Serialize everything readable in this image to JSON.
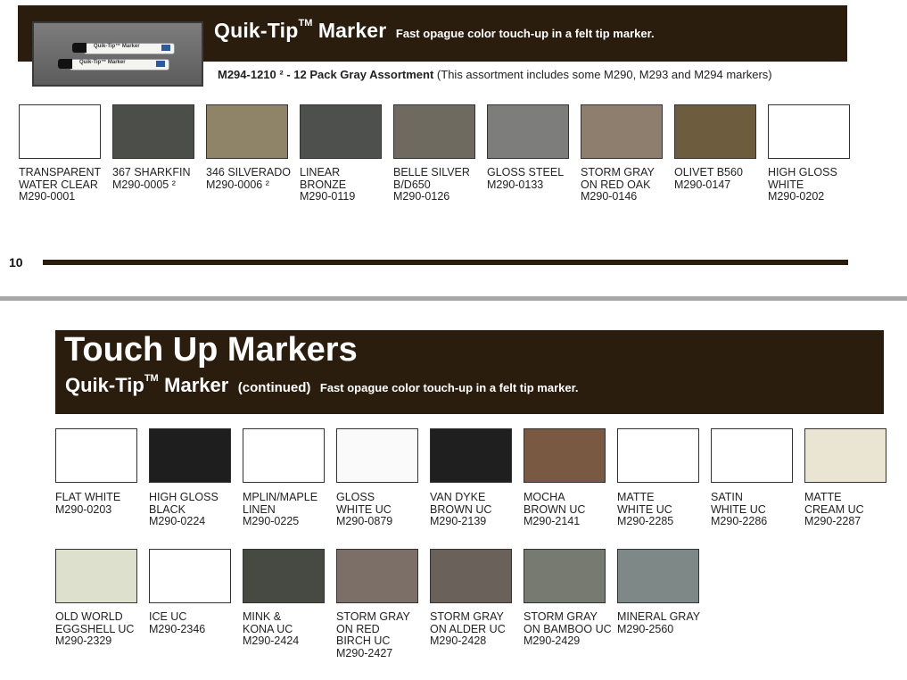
{
  "top_header": {
    "title": "Quik-Tip",
    "trademark": "TM",
    "title_word": "Marker",
    "tagline": "Fast opague color touch-up in a felt tip marker.",
    "pen_label": "Quik-Tip™ Marker"
  },
  "assortment": {
    "code": "M294-1210 ² - 12 Pack Gray Assortment",
    "note": " (This assortment includes some M290, M293 and M294 markers)"
  },
  "top_swatches": [
    {
      "lines": [
        "TRANSPARENT",
        "WATER CLEAR",
        "M290-0001"
      ],
      "color": "#ffffff"
    },
    {
      "lines": [
        "367 SHARKFIN",
        "M290-0005 ²"
      ],
      "color": "#4c4f49"
    },
    {
      "lines": [
        "346 SILVERADO",
        "M290-0006 ²"
      ],
      "color": "#8f8468"
    },
    {
      "lines": [
        "LINEAR",
        "BRONZE",
        "M290-0119"
      ],
      "color": "#4d504c"
    },
    {
      "lines": [
        "BELLE SILVER",
        "B/D650",
        "M290-0126"
      ],
      "color": "#6e6a60"
    },
    {
      "lines": [
        "GLOSS STEEL",
        "M290-0133"
      ],
      "color": "#7d7e7b"
    },
    {
      "lines": [
        "STORM GRAY",
        "ON RED OAK",
        "M290-0146"
      ],
      "color": "#8e7e6d"
    },
    {
      "lines": [
        "OLIVET B560",
        "M290-0147"
      ],
      "color": "#6e5c3f"
    },
    {
      "lines": [
        "HIGH GLOSS",
        "WHITE",
        "M290-0202"
      ],
      "color": "#ffffff"
    }
  ],
  "page_number": "10",
  "bottom_header": {
    "title": "Touch Up Markers",
    "marker": "Quik-Tip",
    "trademark": "TM",
    "marker_word": "Marker",
    "continued": "(continued)",
    "tagline": "Fast opague color touch-up in a felt tip marker."
  },
  "row1_swatches": [
    {
      "lines": [
        "FLAT WHITE",
        "M290-0203"
      ],
      "color": "#ffffff"
    },
    {
      "lines": [
        "HIGH GLOSS",
        "BLACK",
        "M290-0224"
      ],
      "color": "#1e1e1e"
    },
    {
      "lines": [
        "MPLIN/MAPLE",
        "LINEN",
        "M290-0225"
      ],
      "color": "#ffffff"
    },
    {
      "lines": [
        "GLOSS",
        "WHITE UC",
        "M290-0879"
      ],
      "color": "#fafafa"
    },
    {
      "lines": [
        "VAN DYKE",
        "BROWN UC",
        "M290-2139"
      ],
      "color": "#1f1f1f"
    },
    {
      "lines": [
        "MOCHA",
        "BROWN UC",
        "M290-2141"
      ],
      "color": "#7a5942"
    },
    {
      "lines": [
        "MATTE",
        "WHITE UC",
        "M290-2285"
      ],
      "color": "#ffffff"
    },
    {
      "lines": [
        "SATIN",
        "WHITE UC",
        "M290-2286"
      ],
      "color": "#ffffff"
    },
    {
      "lines": [
        "MATTE",
        "CREAM UC",
        "M290-2287"
      ],
      "color": "#eae5d3"
    }
  ],
  "row2_swatches": [
    {
      "lines": [
        "OLD WORLD",
        "EGGSHELL UC",
        "M290-2329"
      ],
      "color": "#dde0cc"
    },
    {
      "lines": [
        "ICE UC",
        "M290-2346"
      ],
      "color": "#ffffff"
    },
    {
      "lines": [
        "MINK &",
        "KONA UC",
        "M290-2424"
      ],
      "color": "#474a42"
    },
    {
      "lines": [
        "STORM GRAY",
        "ON RED",
        "BIRCH UC",
        "M290-2427"
      ],
      "color": "#7c6f68"
    },
    {
      "lines": [
        "STORM GRAY",
        "ON ALDER UC",
        "M290-2428"
      ],
      "color": "#6b615b"
    },
    {
      "lines": [
        "STORM GRAY",
        "ON BAMBOO UC",
        "M290-2429"
      ],
      "color": "#767a70"
    },
    {
      "lines": [
        "MINERAL GRAY",
        "M290-2560"
      ],
      "color": "#7e8886"
    }
  ]
}
